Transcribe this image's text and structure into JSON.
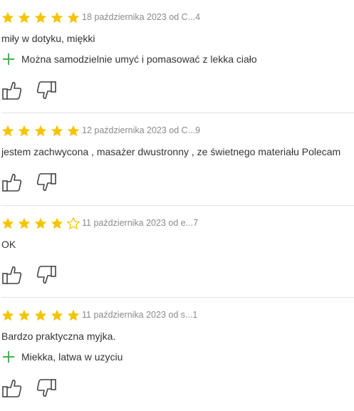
{
  "colors": {
    "star_filled": "#f5c400",
    "star_empty_outline": "#f5c400",
    "pro_plus": "#4caf50",
    "divider": "#e4e4e4",
    "meta_text": "#8a8a8a"
  },
  "reviews": [
    {
      "rating": 5,
      "meta": "18 października 2023 od C...4",
      "text": "miły w dotyku, miękki",
      "pro": "Można samodzielnie umyć i pomasować z lekka ciało"
    },
    {
      "rating": 5,
      "meta": "12 października 2023 od C...9",
      "text": "jestem zachwycona , masażer dwustronny , ze świetnego materiału Polecam",
      "pro": null
    },
    {
      "rating": 4,
      "meta": "11 października 2023 od e...7",
      "text": "OK",
      "pro": null
    },
    {
      "rating": 5,
      "meta": "11 października 2023 od s...1",
      "text": "Bardzo praktyczna myjka.",
      "pro": "Miekka, latwa w uzyciu"
    }
  ]
}
